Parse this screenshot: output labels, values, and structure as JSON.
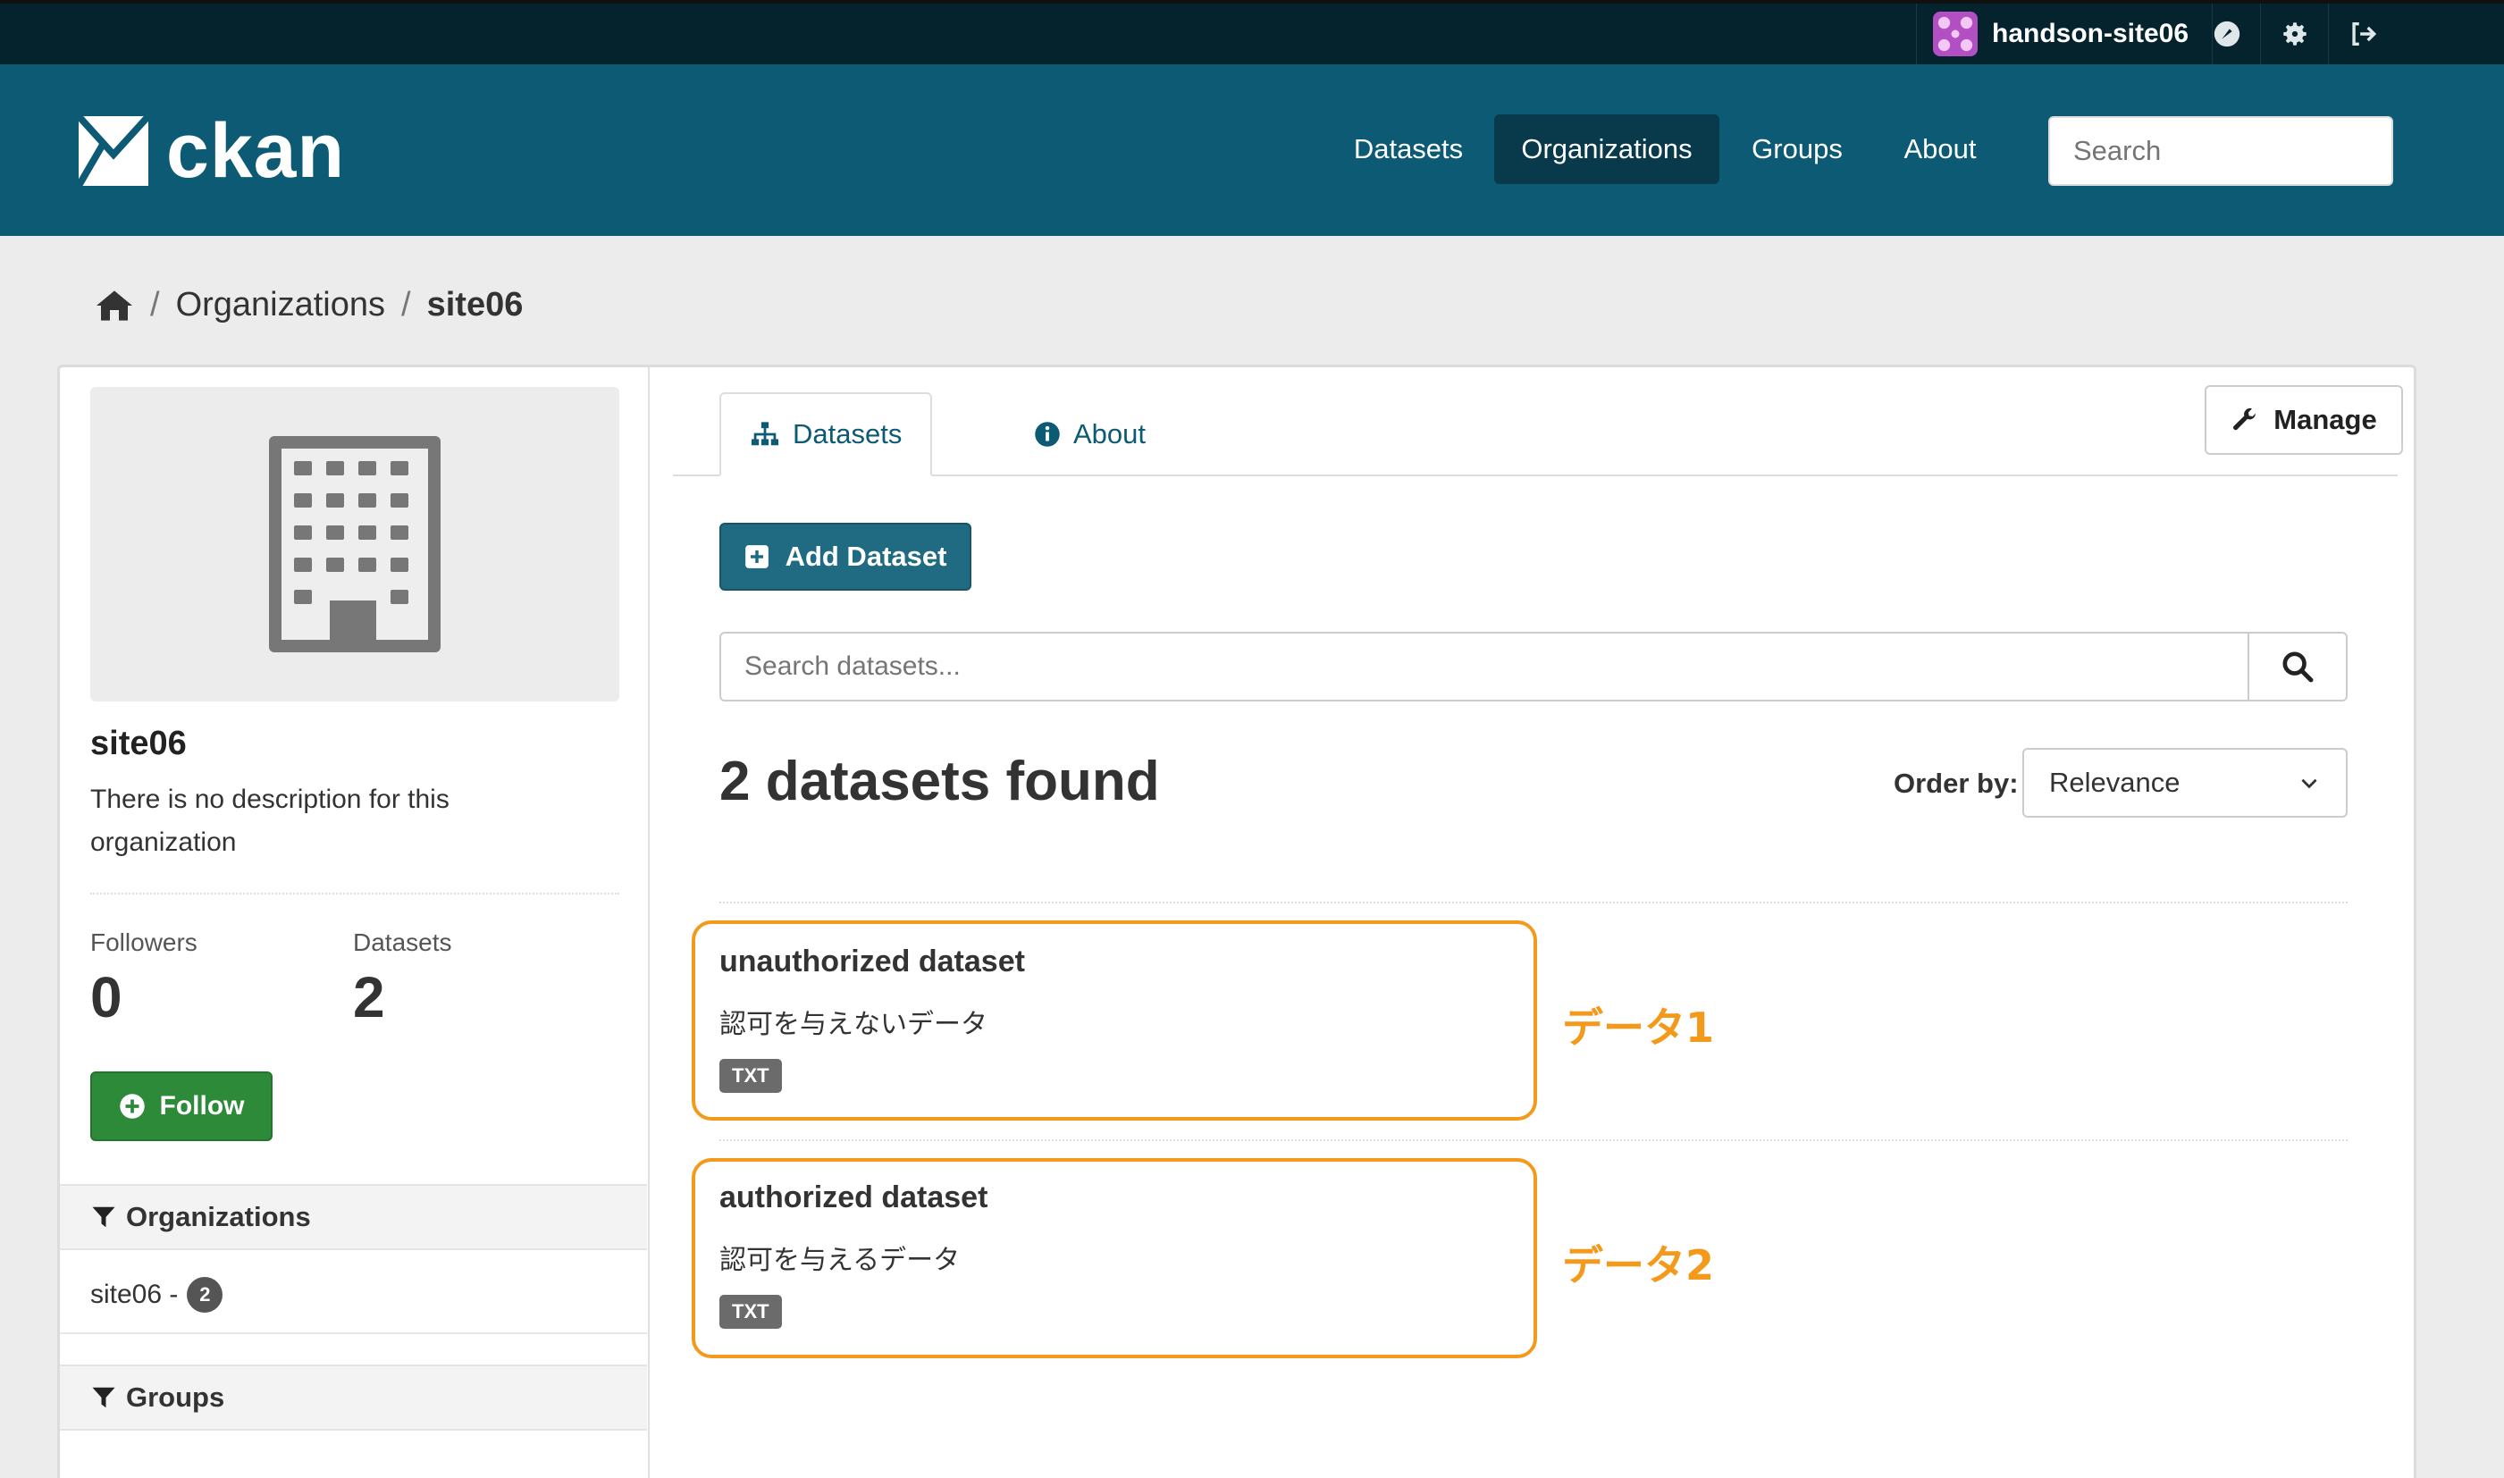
{
  "account": {
    "username": "handson-site06",
    "icons": [
      "dashboard-icon",
      "settings-icon",
      "logout-icon"
    ]
  },
  "header": {
    "logo_text": "ckan",
    "nav": [
      {
        "label": "Datasets",
        "active": false
      },
      {
        "label": "Organizations",
        "active": true
      },
      {
        "label": "Groups",
        "active": false
      },
      {
        "label": "About",
        "active": false
      }
    ],
    "search_placeholder": "Search"
  },
  "breadcrumb": {
    "items": [
      "Organizations",
      "site06"
    ]
  },
  "sidebar": {
    "org_name": "site06",
    "org_description": "There is no description for this organization",
    "stats": {
      "followers_label": "Followers",
      "followers_value": "0",
      "datasets_label": "Datasets",
      "datasets_value": "2"
    },
    "follow_label": "Follow",
    "facets": [
      {
        "heading": "Organizations",
        "items": [
          {
            "label": "site06 -",
            "count": "2"
          }
        ]
      },
      {
        "heading": "Groups",
        "items": []
      }
    ]
  },
  "content": {
    "tabs": [
      {
        "label": "Datasets",
        "active": true
      },
      {
        "label": "About",
        "active": false
      }
    ],
    "manage_label": "Manage",
    "add_dataset_label": "Add Dataset",
    "search_placeholder": "Search datasets...",
    "found_text": "2 datasets found",
    "order_by_label": "Order by:",
    "order_by_value": "Relevance",
    "datasets": [
      {
        "title": "unauthorized dataset",
        "notes": "認可を与えないデータ",
        "format": "TXT",
        "annotation": "データ1"
      },
      {
        "title": "authorized dataset",
        "notes": "認可を与えるデータ",
        "format": "TXT",
        "annotation": "データ2"
      }
    ]
  },
  "colors": {
    "account_bar": "#05232d",
    "masthead": "#0d5a74",
    "nav_active": "#083a4c",
    "follow_button": "#2d8a38",
    "add_button": "#206b82",
    "annotation": "#f39a1c"
  }
}
